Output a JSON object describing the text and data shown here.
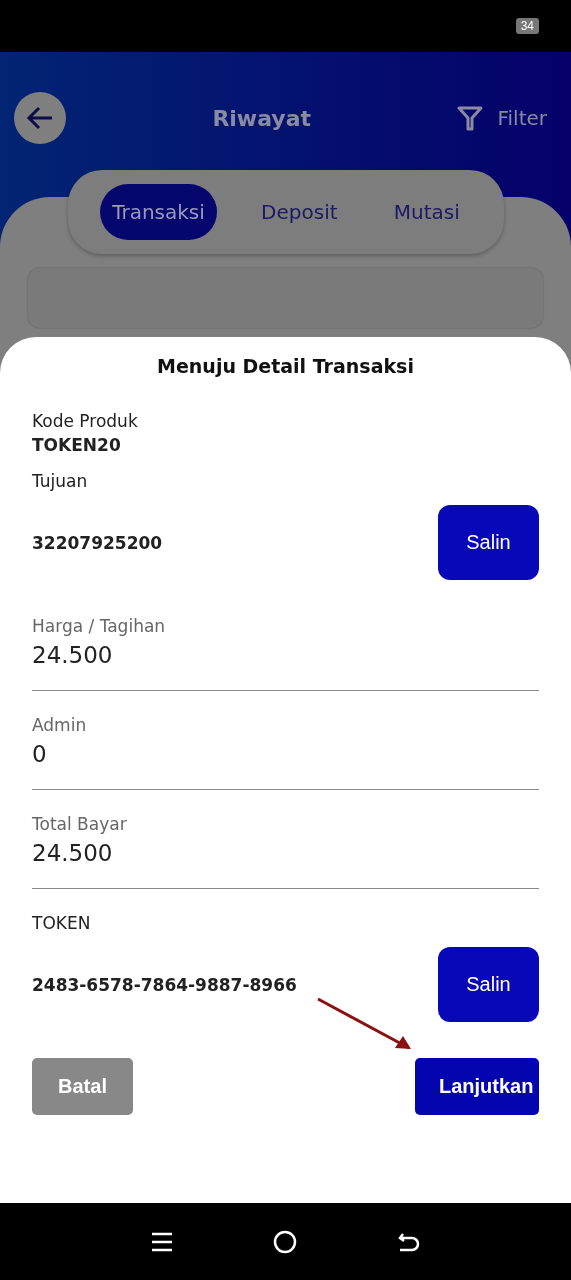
{
  "status_bar": {
    "battery": "34"
  },
  "header": {
    "title": "Riwayat",
    "filter_label": "Filter"
  },
  "tabs": [
    {
      "label": "Transaksi",
      "selected": true
    },
    {
      "label": "Deposit",
      "selected": false
    },
    {
      "label": "Mutasi",
      "selected": false
    }
  ],
  "dialog": {
    "title": "Menuju Detail Transaksi",
    "fields": [
      {
        "kind": "plain",
        "label": "Kode Produk",
        "value": "TOKEN20"
      },
      {
        "kind": "copy",
        "label": "Tujuan",
        "value": "32207925200",
        "button": "Salin"
      },
      {
        "kind": "input",
        "label": "Harga / Tagihan",
        "value": "24.500"
      },
      {
        "kind": "input",
        "label": "Admin",
        "value": "0"
      },
      {
        "kind": "input",
        "label": "Total Bayar",
        "value": "24.500"
      },
      {
        "kind": "copy",
        "label": "TOKEN",
        "value": "2483-6578-7864-9887-8966",
        "button": "Salin"
      }
    ],
    "buttons": [
      {
        "kind": "cancel",
        "label": "Batal"
      },
      {
        "kind": "primary",
        "label": "Lanjutkan"
      }
    ]
  }
}
